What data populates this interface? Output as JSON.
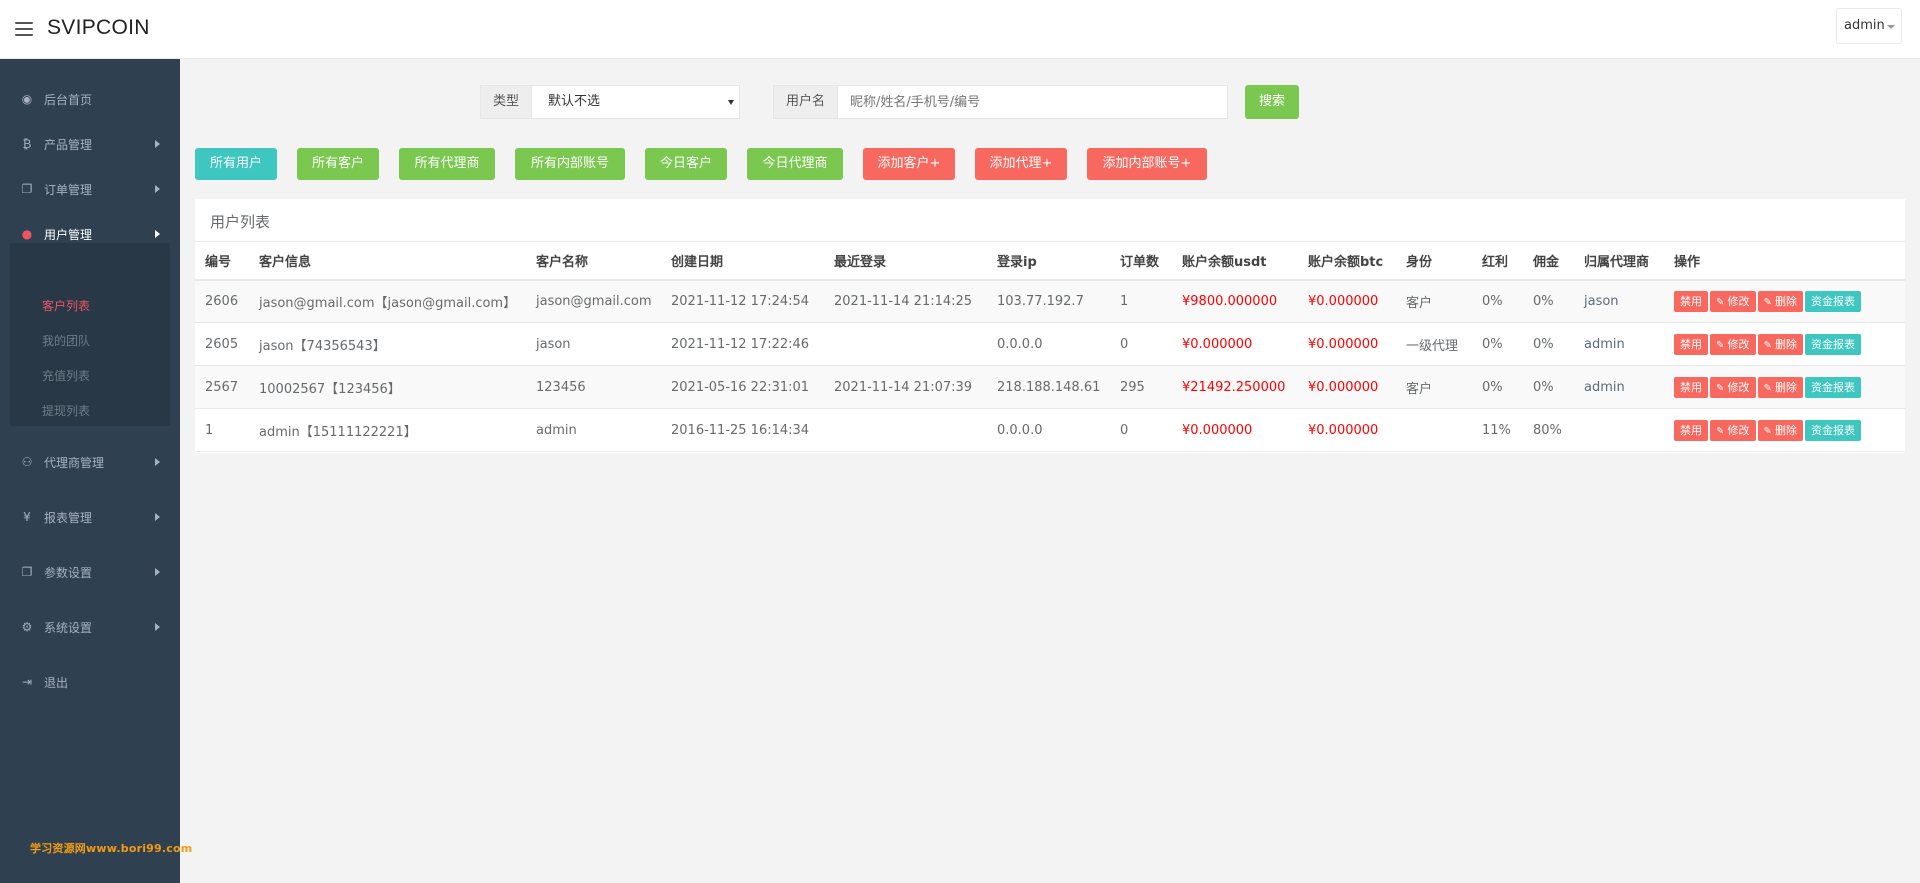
{
  "header": {
    "brand": "SVIPCOIN",
    "user": "admin"
  },
  "sidebar": {
    "items": [
      {
        "label": "后台首页",
        "icon": "dashboard-icon"
      },
      {
        "label": "产品管理",
        "icon": "bitcoin-icon"
      },
      {
        "label": "订单管理",
        "icon": "copy-icon"
      },
      {
        "label": "用户管理",
        "icon": "user-icon"
      },
      {
        "label": "代理商管理",
        "icon": "sitemap-icon"
      },
      {
        "label": "报表管理",
        "icon": "yen-icon"
      },
      {
        "label": "参数设置",
        "icon": "copy-icon"
      },
      {
        "label": "系统设置",
        "icon": "gears-icon"
      },
      {
        "label": "退出",
        "icon": "sign-out-icon"
      }
    ],
    "sub_items": [
      "客户列表",
      "我的团队",
      "充值列表",
      "提现列表"
    ]
  },
  "watermark": "学习资源网www.bori99.com",
  "filters": {
    "type_label": "类型",
    "type_value": "默认不选",
    "user_label": "用户名",
    "user_placeholder": "昵称/姓名/手机号/编号",
    "search": "搜索"
  },
  "actions": [
    "所有用户",
    "所有客户",
    "所有代理商",
    "所有内部账号",
    "今日客户",
    "今日代理商",
    "添加客户+",
    "添加代理+",
    "添加内部账号+"
  ],
  "table": {
    "title": "用户列表",
    "headers": [
      "编号",
      "客户信息",
      "客户名称",
      "创建日期",
      "最近登录",
      "登录ip",
      "订单数",
      "账户余额usdt",
      "账户余额btc",
      "身份",
      "红利",
      "佣金",
      "归属代理商",
      "操作"
    ],
    "rows": [
      [
        "2606",
        "jason@gmail.com【jason@gmail.com】",
        "jason@gmail.com",
        "2021-11-12 17:24:54",
        "2021-11-14 21:14:25",
        "103.77.192.7",
        "1",
        "¥9800.000000",
        "¥0.000000",
        "客户",
        "0%",
        "0%",
        "jason"
      ],
      [
        "2605",
        "jason【74356543】",
        "jason",
        "2021-11-12 17:22:46",
        "",
        "0.0.0.0",
        "0",
        "¥0.000000",
        "¥0.000000",
        "一级代理",
        "0%",
        "0%",
        "admin"
      ],
      [
        "2567",
        "10002567【123456】",
        "123456",
        "2021-05-16 22:31:01",
        "2021-11-14 21:07:39",
        "218.188.148.61",
        "295",
        "¥21492.250000",
        "¥0.000000",
        "客户",
        "0%",
        "0%",
        "admin"
      ],
      [
        "1",
        "admin【15111122221】",
        "admin",
        "2016-11-25 16:14:34",
        "",
        "0.0.0.0",
        "0",
        "¥0.000000",
        "¥0.000000",
        "",
        "11%",
        "80%",
        ""
      ]
    ],
    "ops": [
      "禁用",
      "修改",
      "删除",
      "资金报表"
    ]
  },
  "colors": {
    "teal": "#3ec7c0",
    "green": "#7ac84f",
    "red": "#f8685f",
    "sidebar": "#2f4050",
    "money": "#ff0000"
  }
}
